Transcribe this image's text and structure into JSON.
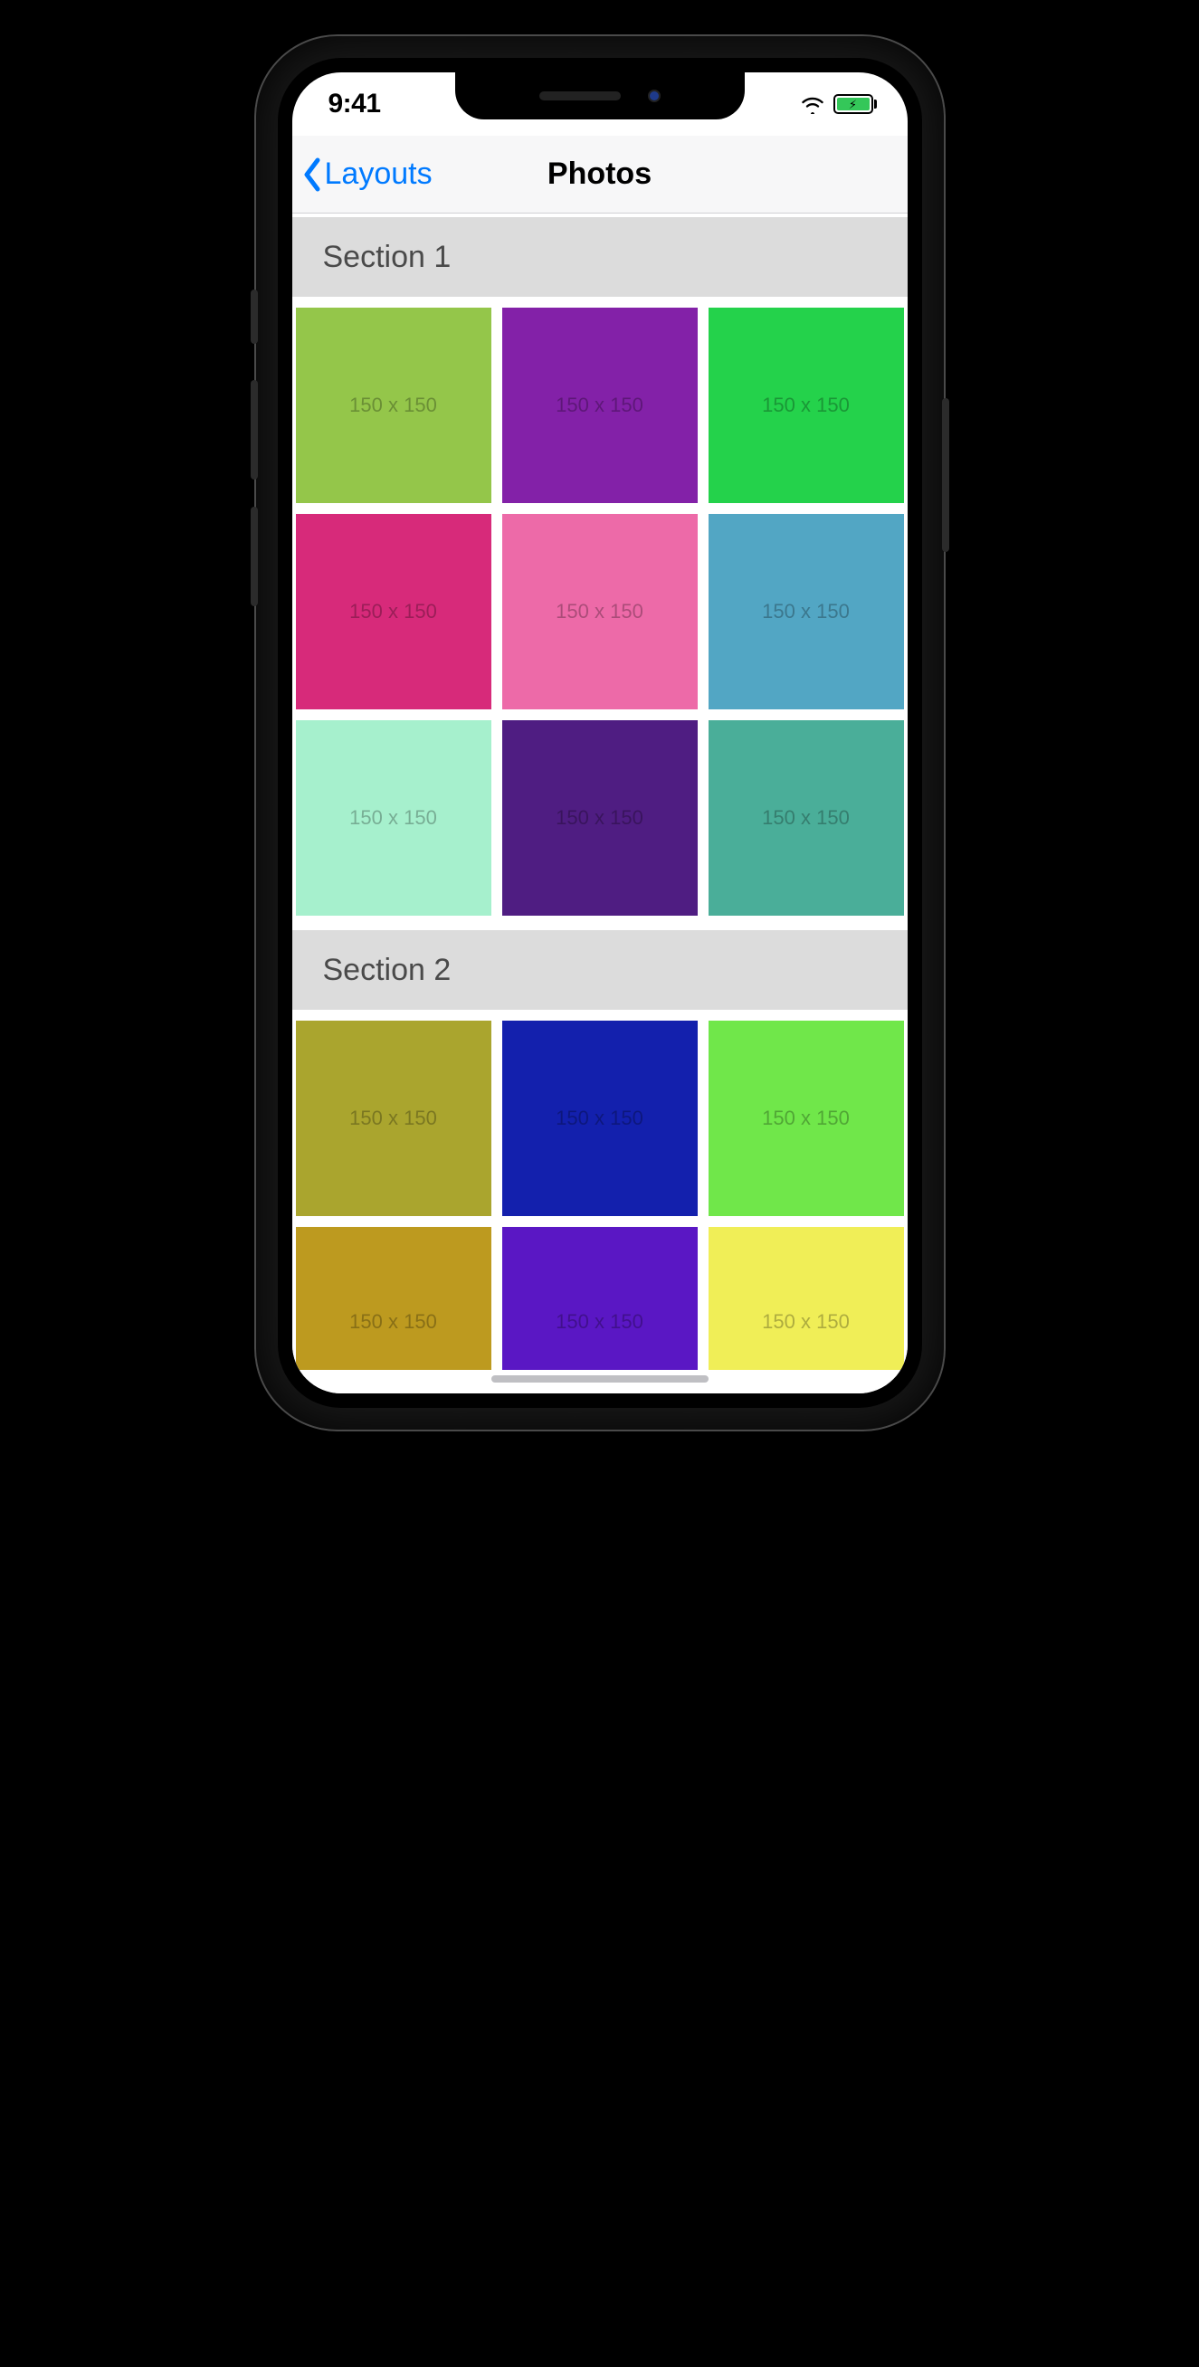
{
  "statusbar": {
    "time": "9:41"
  },
  "navbar": {
    "back_label": "Layouts",
    "title": "Photos"
  },
  "sections": [
    {
      "title": "Section 1",
      "cells": [
        {
          "label": "150 x 150",
          "color": "#94c64a"
        },
        {
          "label": "150 x 150",
          "color": "#8321a8"
        },
        {
          "label": "150 x 150",
          "color": "#24d24b"
        },
        {
          "label": "150 x 150",
          "color": "#d72a7a"
        },
        {
          "label": "150 x 150",
          "color": "#ed6aa8"
        },
        {
          "label": "150 x 150",
          "color": "#52a6c4"
        },
        {
          "label": "150 x 150",
          "color": "#a6f0cd"
        },
        {
          "label": "150 x 150",
          "color": "#4f1d82"
        },
        {
          "label": "150 x 150",
          "color": "#4aae99"
        }
      ]
    },
    {
      "title": "Section 2",
      "cells": [
        {
          "label": "150 x 150",
          "color": "#aaa52e"
        },
        {
          "label": "150 x 150",
          "color": "#1320ad"
        },
        {
          "label": "150 x 150",
          "color": "#70e74a"
        },
        {
          "label": "150 x 150",
          "color": "#bd9a1f"
        },
        {
          "label": "150 x 150",
          "color": "#5a17c4"
        },
        {
          "label": "150 x 150",
          "color": "#f0ee57"
        }
      ]
    }
  ]
}
